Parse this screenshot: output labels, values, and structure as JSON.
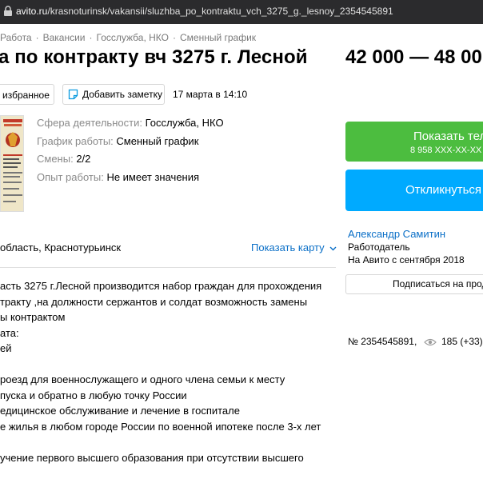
{
  "browser": {
    "url_host": "avito.ru",
    "url_path": "/krasnoturinsk/vakansii/sluzhba_po_kontraktu_vch_3275_g._lesnoy_2354545891"
  },
  "breadcrumbs": [
    "Работа",
    "Вакансии",
    "Госслужба, НКО",
    "Сменный график"
  ],
  "breadcrumb_sep": "·",
  "title": "а по контракту вч 3275 г. Лесной",
  "price": "42 000 — 48 00",
  "actions": {
    "favorite_label": "избранное",
    "note_label": "Добавить заметку",
    "date": "17 марта в 14:10"
  },
  "params": [
    {
      "key": "Сфера деятельности: ",
      "value": "Госслужба, НКО"
    },
    {
      "key": "График работы: ",
      "value": "Сменный график"
    },
    {
      "key": "Смены: ",
      "value": "2/2"
    },
    {
      "key": "Опыт работы: ",
      "value": "Не имеет значения"
    }
  ],
  "location": "область, Краснотурьинск",
  "show_map": "Показать карту",
  "description": [
    "асть 3275 г.Лесной производится набор граждан для прохождения",
    "тракту ,на должности сержантов и солдат возможность замены",
    "ы контрактом",
    "ата:",
    "ей",
    "",
    "роезд для военнослужащего и одного члена семьи к месту",
    "пуска и обратно в любую точку России",
    "едицинское обслуживание и лечение в госпитале",
    "е жилья в любом городе России по военной ипотеке после 3-х лет",
    "",
    "учение первого высшего образования при отсутствии высшего"
  ],
  "sidebar": {
    "phone_label": "Показать телеф",
    "phone_number": "8 958 XXX-XX-XX",
    "reply_label": "Откликнуться",
    "seller_name": "Александр Самитин",
    "seller_role": "Работодатель",
    "seller_since": "На Авито с сентября 2018",
    "subscribe_label": "Подписаться на прода",
    "ad_number": "№ 2354545891,",
    "views": "185 (+33)"
  },
  "colors": {
    "green": "#4cbd3f",
    "blue": "#00aaff",
    "link": "#0a6fc7"
  }
}
